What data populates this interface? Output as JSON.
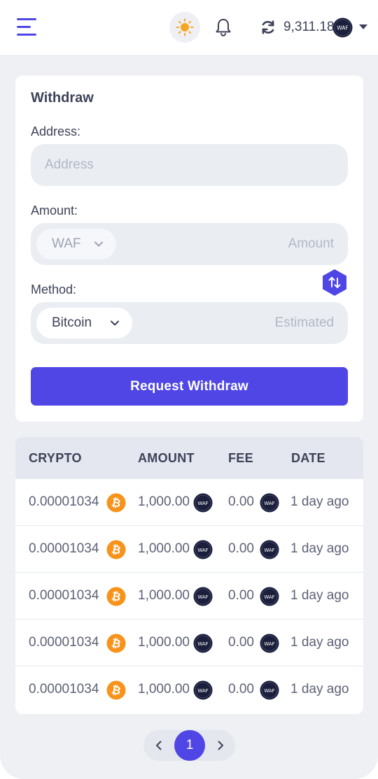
{
  "header": {
    "balance": "9,311.18",
    "coin_label": "WAF",
    "icons": [
      "menu-icon",
      "sun-icon",
      "bell-icon",
      "refresh-icon",
      "caret-down-icon"
    ]
  },
  "withdraw": {
    "title": "Withdraw",
    "address_label": "Address:",
    "address_placeholder": "Address",
    "amount_label": "Amount:",
    "amount_currency": "WAF",
    "amount_placeholder": "Amount",
    "method_label": "Method:",
    "method_value": "Bitcoin",
    "estimated_placeholder": "Estimated",
    "submit_label": "Request Withdraw"
  },
  "table": {
    "columns": [
      "CRYPTO",
      "AMOUNT",
      "FEE",
      "DATE"
    ],
    "rows": [
      {
        "crypto": "0.00001034",
        "amount": "1,000.00",
        "fee": "0.00",
        "date": "1 day ago"
      },
      {
        "crypto": "0.00001034",
        "amount": "1,000.00",
        "fee": "0.00",
        "date": "1 day ago"
      },
      {
        "crypto": "0.00001034",
        "amount": "1,000.00",
        "fee": "0.00",
        "date": "1 day ago"
      },
      {
        "crypto": "0.00001034",
        "amount": "1,000.00",
        "fee": "0.00",
        "date": "1 day ago"
      },
      {
        "crypto": "0.00001034",
        "amount": "1,000.00",
        "fee": "0.00",
        "date": "1 day ago"
      }
    ]
  },
  "pagination": {
    "current": "1"
  },
  "colors": {
    "accent": "#4f46e5",
    "bitcoin": "#f7931a",
    "waf_coin": "#1b1f3b",
    "sun": "#f5a623"
  }
}
